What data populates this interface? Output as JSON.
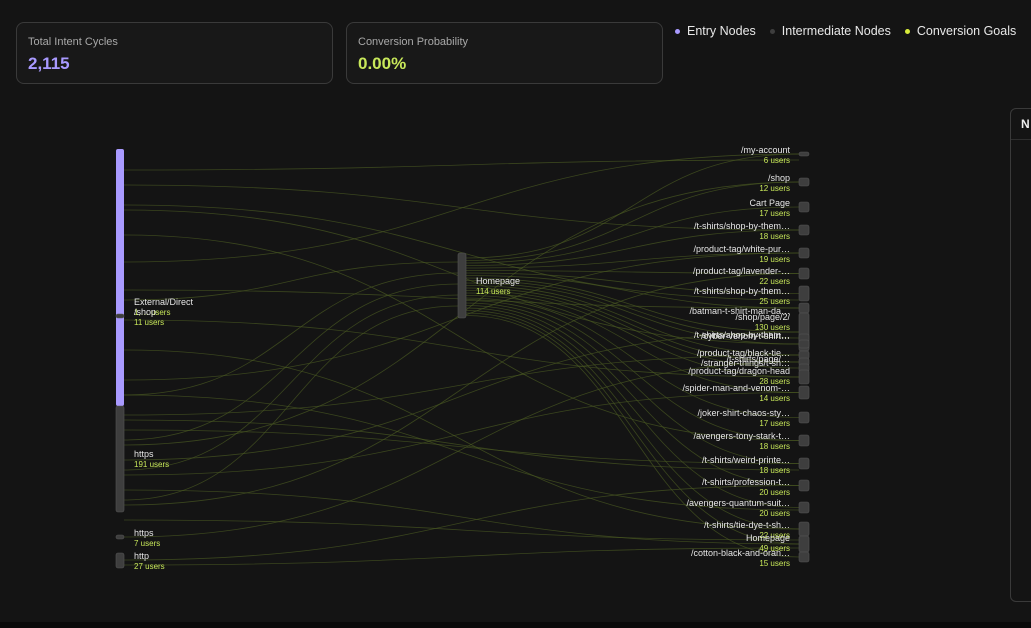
{
  "stats": {
    "total_intent_cycles": {
      "label": "Total Intent Cycles",
      "value": "2,115"
    },
    "conversion_probability": {
      "label": "Conversion Probability",
      "value": "0.00%"
    }
  },
  "legend": [
    {
      "label": "Entry Nodes",
      "color": "#a99aff"
    },
    {
      "label": "Intermediate Nodes",
      "color": "#3e3e3e"
    },
    {
      "label": "Conversion Goals",
      "color": "#d8ec3a"
    }
  ],
  "side_panel": {
    "title": "N"
  },
  "colors": {
    "entry": "#a99aff",
    "intermediate": "#3e3e3e",
    "goal": "#d8ec3a",
    "link": "#4a5a22",
    "count_text": "#c8e85a"
  },
  "diagram": {
    "source_nodes": [
      {
        "name": "External/Direct",
        "count": "1,… users",
        "kind": "entry"
      },
      {
        "name": "/shop",
        "count": "11 users",
        "kind": "intermediate"
      },
      {
        "name": "https",
        "count": "191 users",
        "kind": "intermediate"
      },
      {
        "name": "https",
        "count": "7 users",
        "kind": "intermediate"
      },
      {
        "name": "http",
        "count": "27 users",
        "kind": "intermediate"
      }
    ],
    "middle_nodes": [
      {
        "name": "Homepage",
        "count": "114 users",
        "kind": "intermediate"
      }
    ],
    "target_nodes": [
      {
        "name": "/my-account",
        "count": "6 users"
      },
      {
        "name": "/shop",
        "count": "12 users"
      },
      {
        "name": "Cart Page",
        "count": "17 users"
      },
      {
        "name": "/t-shirts/shop-by-them…",
        "count": "18 users"
      },
      {
        "name": "/product-tag/white-pur…",
        "count": "19 users"
      },
      {
        "name": "/product-tag/lavender-…",
        "count": "22 users"
      },
      {
        "name": "/t-shirts/shop-by-them…",
        "count": "25 users"
      },
      {
        "name": "/batman-t-shirt-man-da…",
        "count": ""
      },
      {
        "name": "/shop/page/2/",
        "count": "130 users"
      },
      {
        "name": "/t-shirts/shop-by-them…",
        "count": ""
      },
      {
        "name": "/cyber-venom-t-shirt…",
        "count": ""
      },
      {
        "name": "/product-tag/black-tie…",
        "count": ""
      },
      {
        "name": "/t-shirts/page/…",
        "count": ""
      },
      {
        "name": "/stranger-things/t-sh…",
        "count": ""
      },
      {
        "name": "/product-tag/dragon-head",
        "count": "28 users"
      },
      {
        "name": "/spider-man-and-venom-…",
        "count": "14 users"
      },
      {
        "name": "/joker-shirt-chaos-sty…",
        "count": "17 users"
      },
      {
        "name": "/avengers-tony-stark-t…",
        "count": "18 users"
      },
      {
        "name": "/t-shirts/weird-printe…",
        "count": "18 users"
      },
      {
        "name": "/t-shirts/profession-t…",
        "count": "20 users"
      },
      {
        "name": "/avengers-quantum-suit…",
        "count": "20 users"
      },
      {
        "name": "/t-shirts/tie-dye-t-sh…",
        "count": "22 users"
      },
      {
        "name": "Homepage",
        "count": "49 users"
      },
      {
        "name": "/cotton-black-and-oran…",
        "count": "15 users"
      }
    ]
  }
}
